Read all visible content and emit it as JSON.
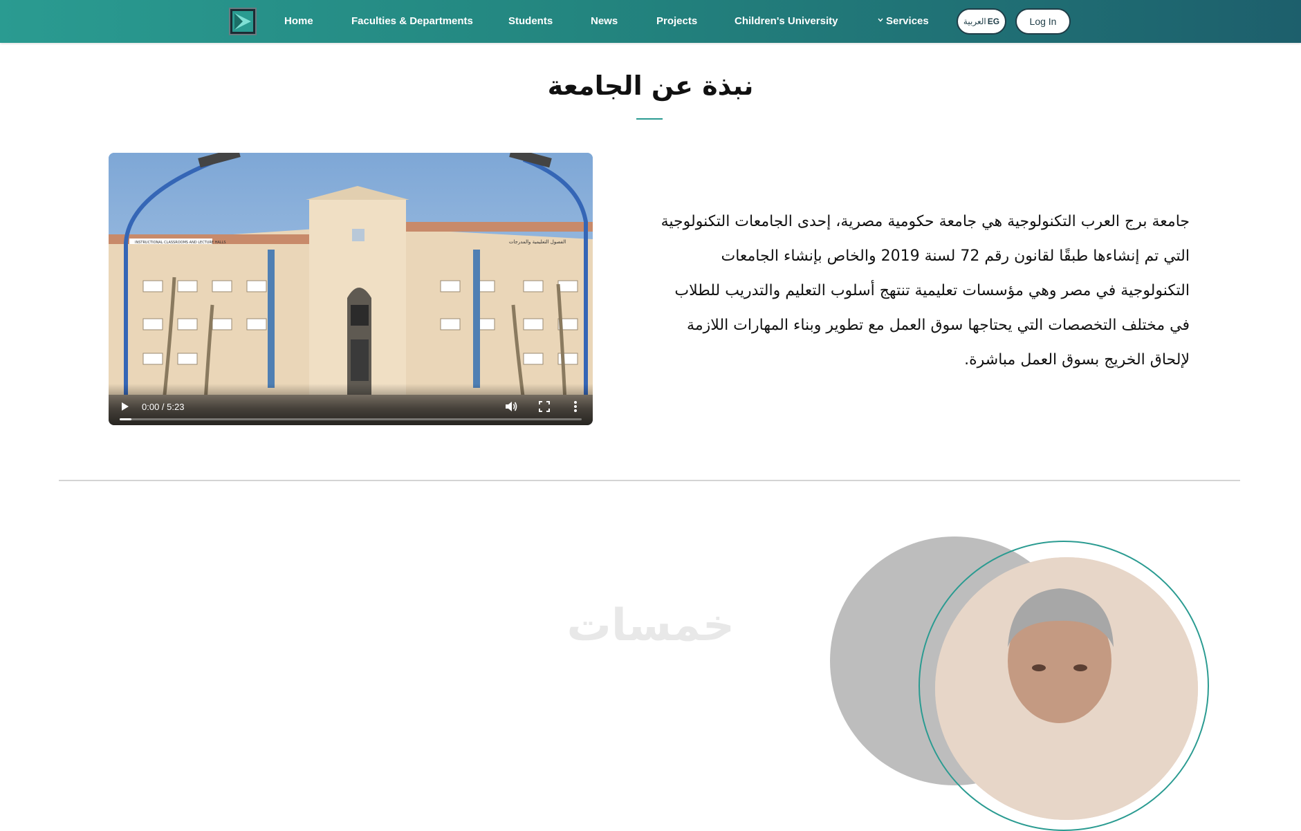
{
  "nav": {
    "items": [
      "Home",
      "Faculties & Departments",
      "Students",
      "News",
      "Projects",
      "Children's University",
      "Services"
    ],
    "lang_label": "العربية",
    "lang_code": "EG",
    "login_label": "Log In"
  },
  "about": {
    "title": "نبذة عن الجامعة",
    "paragraph": "جامعة برج العرب التكنولوجية هي جامعة حكومية مصرية، إحدى الجامعات التكنولوجية التي تم إنشاءها طبقًا لقانون رقم 72 لسنة 2019 والخاص بإنشاء الجامعات التكنولوجية في مصر وهي مؤسسات تعليمية تنتهج أسلوب التعليم والتدريب للطلاب في مختلف التخصصات التي يحتاجها سوق العمل مع تطوير وبناء المهارات اللازمة لإلحاق الخريج بسوق العمل مباشرة."
  },
  "video": {
    "time": "0:00 / 5:23",
    "progress_fraction": 0.025,
    "sign_left": "INSTRUCTIONAL CLASSROOMS AND LECTURE HALLS",
    "sign_right": "الفصول التعليمية والمدرجات"
  },
  "watermark": "خمسات",
  "colors": {
    "header_start": "#2a9b91",
    "header_end": "#1d5f6c",
    "accent": "#2a9b91"
  }
}
